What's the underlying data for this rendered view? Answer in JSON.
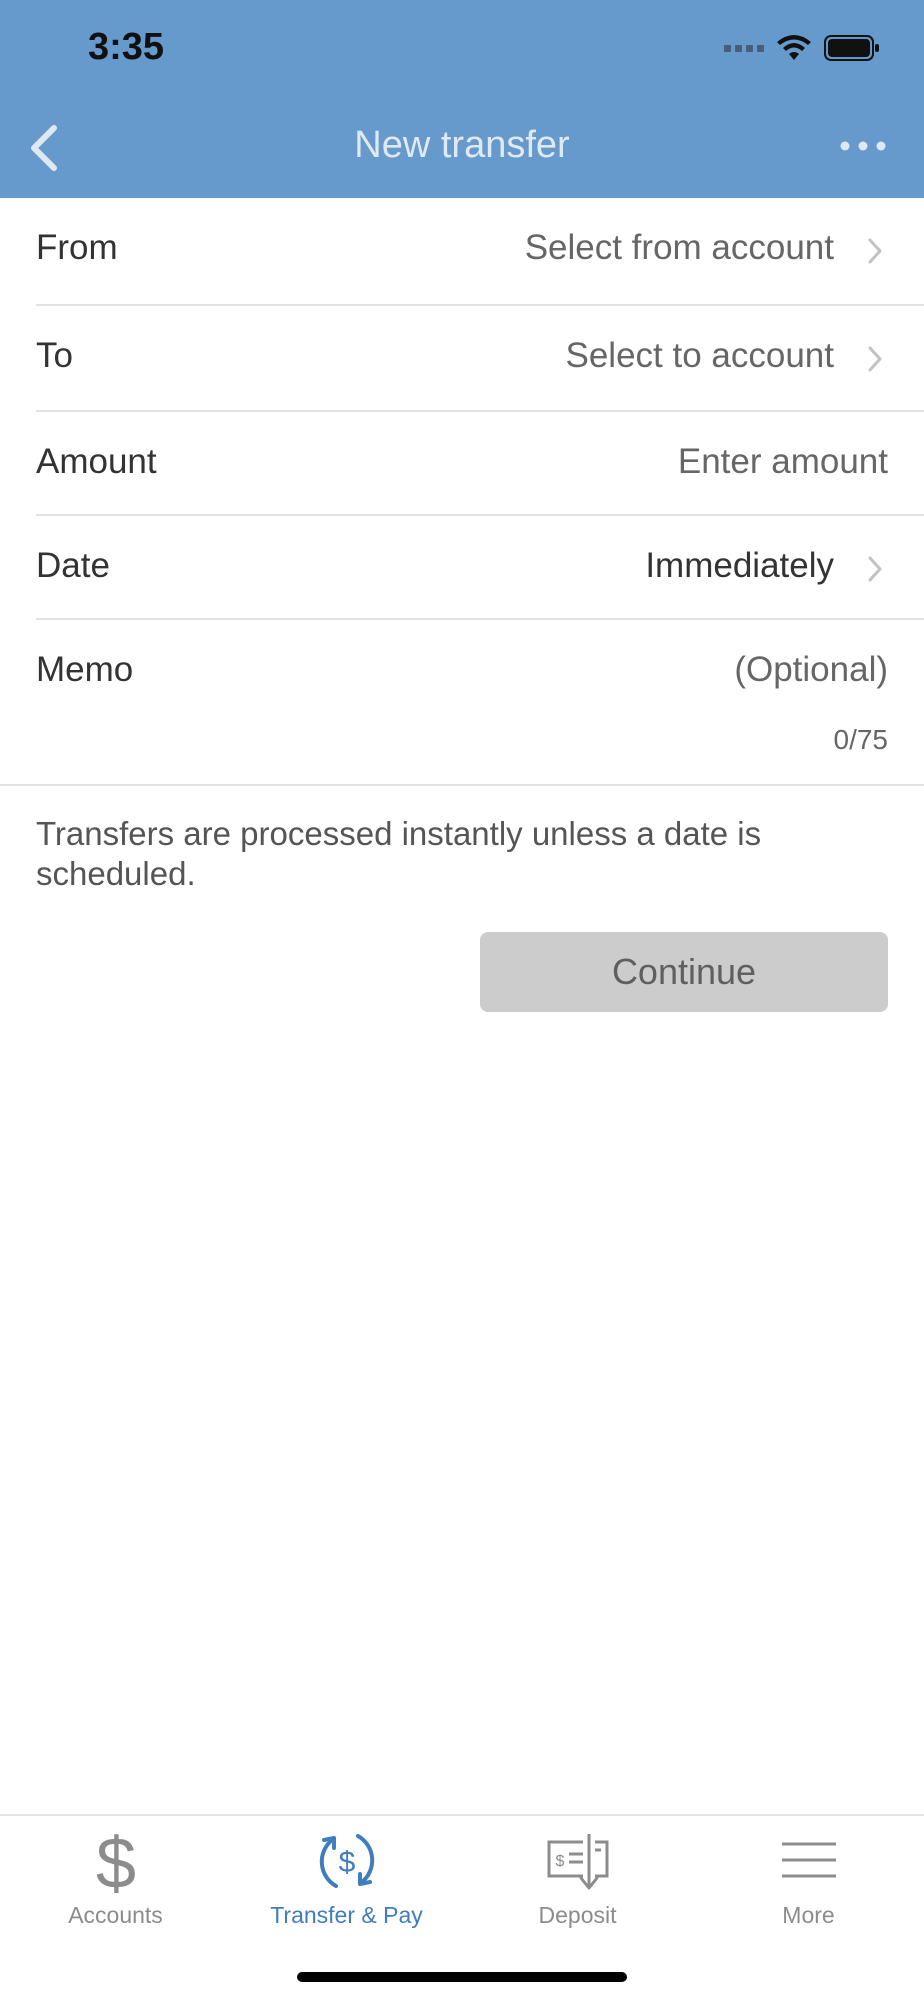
{
  "status_bar": {
    "time": "3:35"
  },
  "header": {
    "title": "New transfer"
  },
  "form": {
    "from": {
      "label": "From",
      "value": "Select from account"
    },
    "to": {
      "label": "To",
      "value": "Select to account"
    },
    "amount": {
      "label": "Amount",
      "placeholder": "Enter amount"
    },
    "date": {
      "label": "Date",
      "value": "Immediately"
    },
    "memo": {
      "label": "Memo",
      "placeholder": "(Optional)",
      "count": "0/75"
    }
  },
  "note": "Transfers are processed instantly unless a date is scheduled.",
  "continue_label": "Continue",
  "tabbar": {
    "items": [
      {
        "label": "Accounts",
        "icon": "dollar-icon",
        "active": false
      },
      {
        "label": "Transfer & Pay",
        "icon": "transfer-pay-icon",
        "active": true
      },
      {
        "label": "Deposit",
        "icon": "check-deposit-icon",
        "active": false
      },
      {
        "label": "More",
        "icon": "menu-icon",
        "active": false
      }
    ]
  },
  "colors": {
    "header_bg": "#6699CC",
    "accent": "#3F7DC0",
    "button_disabled": "#CCCCCC"
  }
}
